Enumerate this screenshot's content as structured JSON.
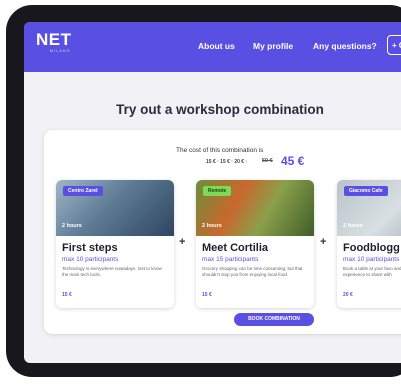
{
  "header": {
    "logo": "NET",
    "logo_sub": "MILANO",
    "nav": [
      "About us",
      "My profile",
      "Any questions?"
    ],
    "cta": "+ O"
  },
  "main": {
    "title": "Try out a workshop combination",
    "cost_label": "The cost of this combination is",
    "cost_parts": "15 € · 15 € · 20 € · ",
    "cost_old": "50 €",
    "cost_total": "45 €",
    "book_button": "BOOK COMBINATION",
    "cards": [
      {
        "badge": "Centro Zaret",
        "badge_color": "#5a4fe3",
        "hours": "2 hours",
        "title": "First steps",
        "participants": "max 10 participants",
        "description": "Technology is everywhere nowadays. Get to know the main tech tools.",
        "price": "15 €"
      },
      {
        "badge": "Remote",
        "badge_color": "#7ed957",
        "hours": "2 hours",
        "title": "Meet Cortilia",
        "participants": "max 15 participants",
        "description": "Grocery shopping can be time consuming, but that shouldn't stop you from enjoying local food.",
        "price": "15 €"
      },
      {
        "badge": "Giacomo Cafe",
        "badge_color": "#5a4fe3",
        "hours": "2 hours",
        "title": "Foodblogg",
        "participants": "max 10 participants",
        "description": "Book a table at your favo and take pics of your goo experience to share with",
        "price": "20 €"
      }
    ]
  }
}
